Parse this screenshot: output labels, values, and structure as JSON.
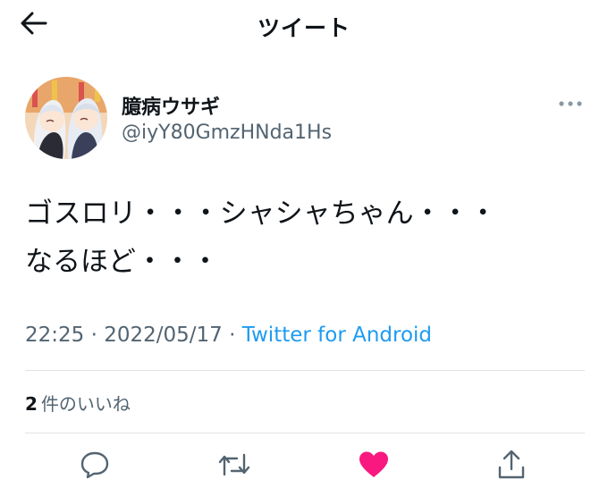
{
  "header": {
    "title": "ツイート",
    "back_icon": "arrow-left-icon"
  },
  "author": {
    "display_name": "臆病ウサギ",
    "handle": "@iyY80GmzHNda1Hs",
    "more_icon": "more-horizontal-icon"
  },
  "tweet": {
    "lines": [
      "ゴスロリ・・・シャシャちゃん・・・",
      "なるほど・・・"
    ]
  },
  "meta": {
    "time": "22:25",
    "separator": " · ",
    "date": "2022/05/17",
    "source": "Twitter for Android"
  },
  "stats": {
    "likes_count": "2",
    "likes_label": "件のいいね"
  },
  "actions": {
    "reply_icon": "reply-icon",
    "retweet_icon": "retweet-icon",
    "like_icon": "heart-filled-icon",
    "share_icon": "share-icon"
  },
  "colors": {
    "accent": "#1d9bf0",
    "like": "#f91880",
    "muted": "#536471",
    "text": "#0f1419"
  }
}
